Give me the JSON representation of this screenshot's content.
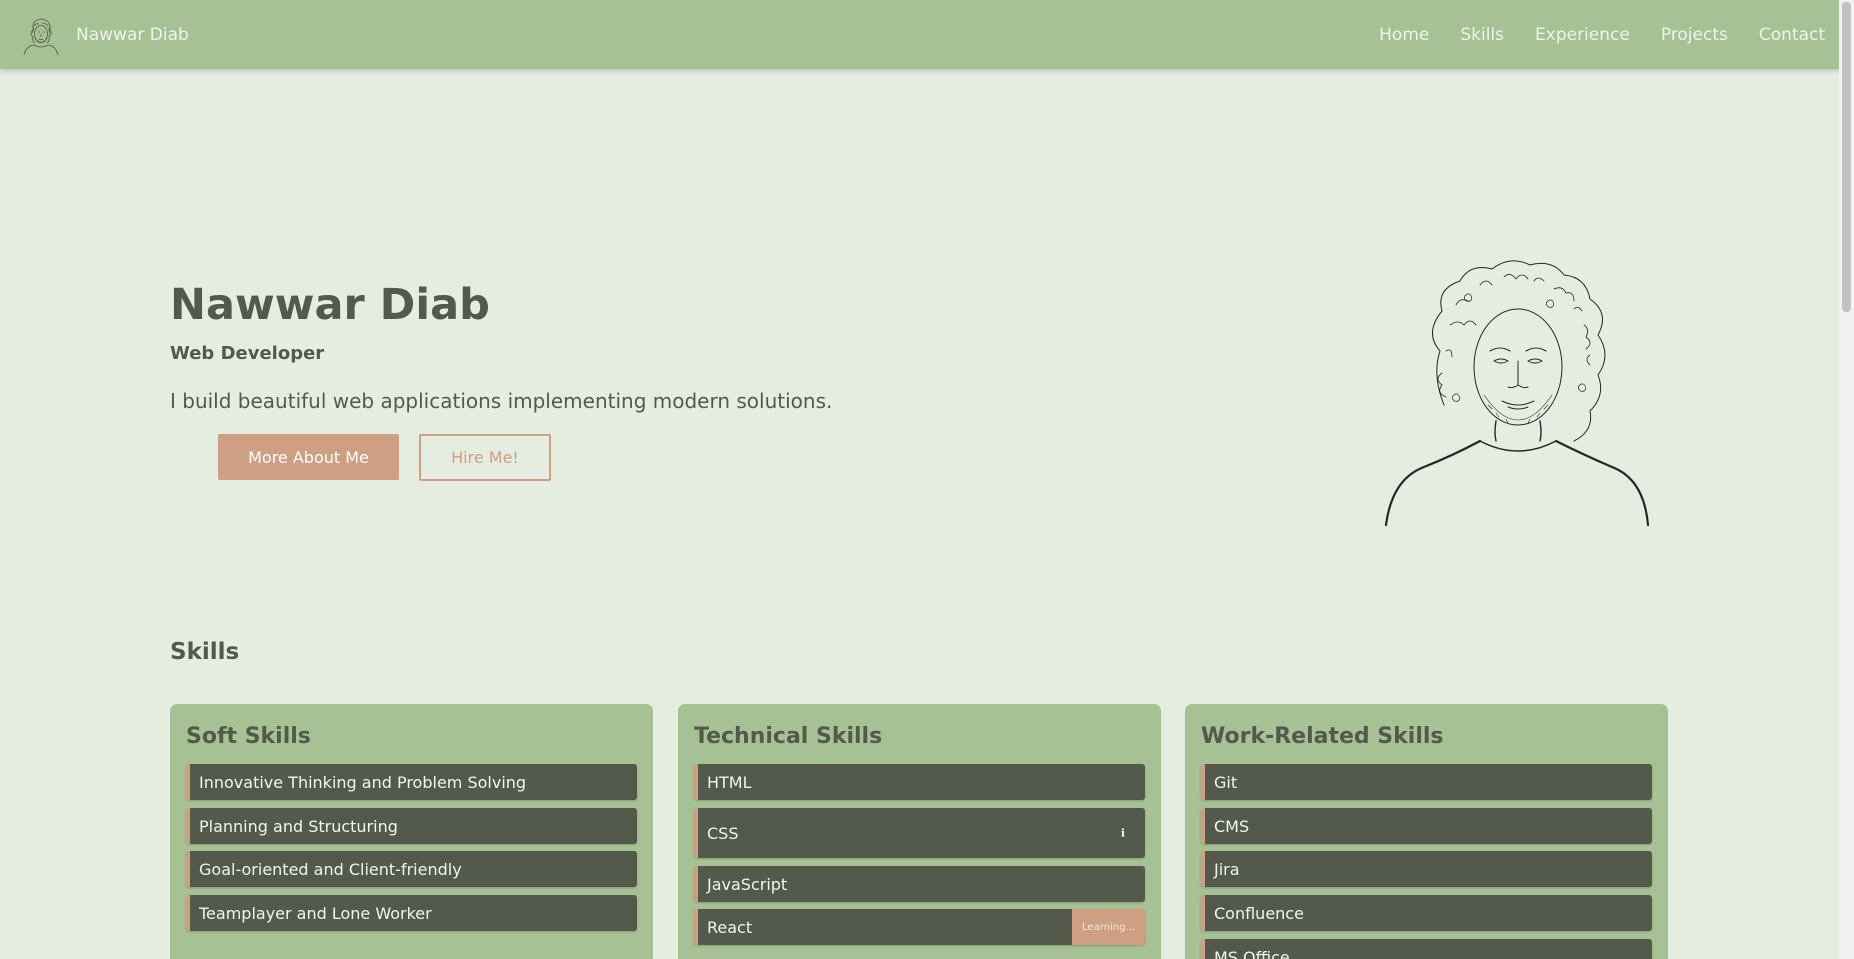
{
  "navbar": {
    "brand_name": "Nawwar Diab",
    "logo_icon": "portrait-sketch-logo",
    "links": [
      "Home",
      "Skills",
      "Experience",
      "Projects",
      "Contact"
    ]
  },
  "hero": {
    "name": "Nawwar Diab",
    "role": "Web Developer",
    "tagline": "I build beautiful web applications implementing modern solutions.",
    "primary_button": "More About Me",
    "secondary_button": "Hire Me!",
    "portrait_icon": "portrait-sketch"
  },
  "skills": {
    "title": "Skills",
    "cards": [
      {
        "title": "Soft Skills",
        "items": [
          "Innovative Thinking and Problem Solving",
          "Planning and Structuring",
          "Goal-oriented and Client-friendly",
          "Teamplayer and Lone Worker"
        ]
      },
      {
        "title": "Technical Skills",
        "items": [
          "HTML",
          "CSS",
          "JavaScript",
          "React"
        ],
        "css_info": "ℹ",
        "react_badge": "Learning..."
      },
      {
        "title": "Work-Related Skills",
        "items": [
          "Git",
          "CMS",
          "Jira",
          "Confluence",
          "MS Office"
        ]
      }
    ]
  },
  "colors": {
    "navbar": "#a6c294",
    "background": "#e5ede1",
    "text": "#535a4c",
    "accent": "#cf9f84",
    "skill_bar": "#535a4c"
  }
}
